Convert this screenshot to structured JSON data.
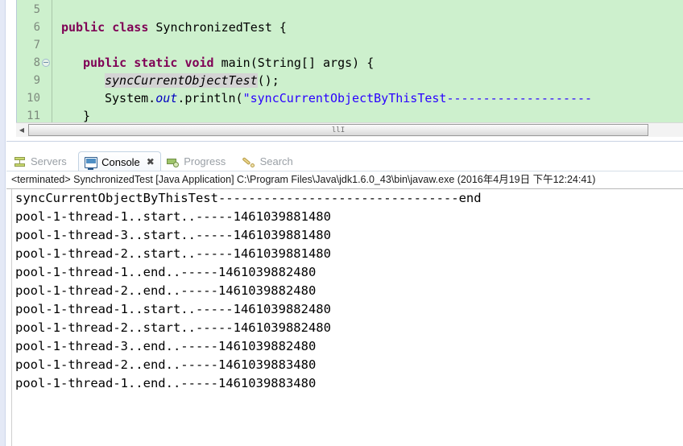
{
  "editor": {
    "lines": [
      {
        "number": "5",
        "fold": false,
        "indent": 0,
        "tokens": []
      },
      {
        "number": "6",
        "fold": false,
        "indent": 0,
        "tokens": [
          {
            "t": "public ",
            "c": "kw"
          },
          {
            "t": "class ",
            "c": "kw"
          },
          {
            "t": "SynchronizedTest {",
            "c": "plain"
          }
        ]
      },
      {
        "number": "7",
        "fold": false,
        "indent": 0,
        "tokens": []
      },
      {
        "number": "8",
        "fold": true,
        "indent": 1,
        "tokens": [
          {
            "t": "public ",
            "c": "kw"
          },
          {
            "t": "static ",
            "c": "kw"
          },
          {
            "t": "void ",
            "c": "kw"
          },
          {
            "t": "main(String[] args) {",
            "c": "plain"
          }
        ]
      },
      {
        "number": "9",
        "fold": false,
        "indent": 2,
        "tokens": [
          {
            "t": "syncCurrentObjectTest",
            "c": "mcall"
          },
          {
            "t": "();",
            "c": "plain"
          }
        ]
      },
      {
        "number": "10",
        "fold": false,
        "indent": 2,
        "tokens": [
          {
            "t": "System.",
            "c": "plain"
          },
          {
            "t": "out",
            "c": "field"
          },
          {
            "t": ".println(",
            "c": "plain"
          },
          {
            "t": "\"syncCurrentObjectByThisTest--------------------",
            "c": "str"
          }
        ]
      },
      {
        "number": "11",
        "fold": false,
        "indent": 1,
        "tokens": [
          {
            "t": "}",
            "c": "plain"
          }
        ]
      }
    ],
    "scrollbar": {
      "left_arrow": "◀",
      "grip": "llI"
    }
  },
  "tabs": [
    {
      "label": "Servers",
      "icon": "servers-icon",
      "active": false,
      "closable": false
    },
    {
      "label": "Console",
      "icon": "console-icon",
      "active": true,
      "closable": true,
      "close_glyph": "✖"
    },
    {
      "label": "Progress",
      "icon": "progress-icon",
      "active": false,
      "closable": false
    },
    {
      "label": "Search",
      "icon": "search-icon",
      "active": false,
      "closable": false
    }
  ],
  "console": {
    "header": "<terminated> SynchronizedTest [Java Application] C:\\Program Files\\Java\\jdk1.6.0_43\\bin\\javaw.exe (2016年4月19日 下午12:24:41)",
    "output": [
      "syncCurrentObjectByThisTest--------------------------------end",
      "pool-1-thread-1..start..-----1461039881480",
      "pool-1-thread-3..start..-----1461039881480",
      "pool-1-thread-2..start..-----1461039881480",
      "pool-1-thread-1..end..-----1461039882480",
      "pool-1-thread-2..end..-----1461039882480",
      "pool-1-thread-1..start..-----1461039882480",
      "pool-1-thread-2..start..-----1461039882480",
      "pool-1-thread-3..end..-----1461039882480",
      "pool-1-thread-2..end..-----1461039883480",
      "pool-1-thread-1..end..-----1461039883480"
    ]
  },
  "colors": {
    "editor_background": "#cdf0cd",
    "keyword": "#7f0055",
    "string": "#2a00ff",
    "field": "#0000c0",
    "gutter_text": "#7d8a7d",
    "rail": "#e4e9f6"
  }
}
